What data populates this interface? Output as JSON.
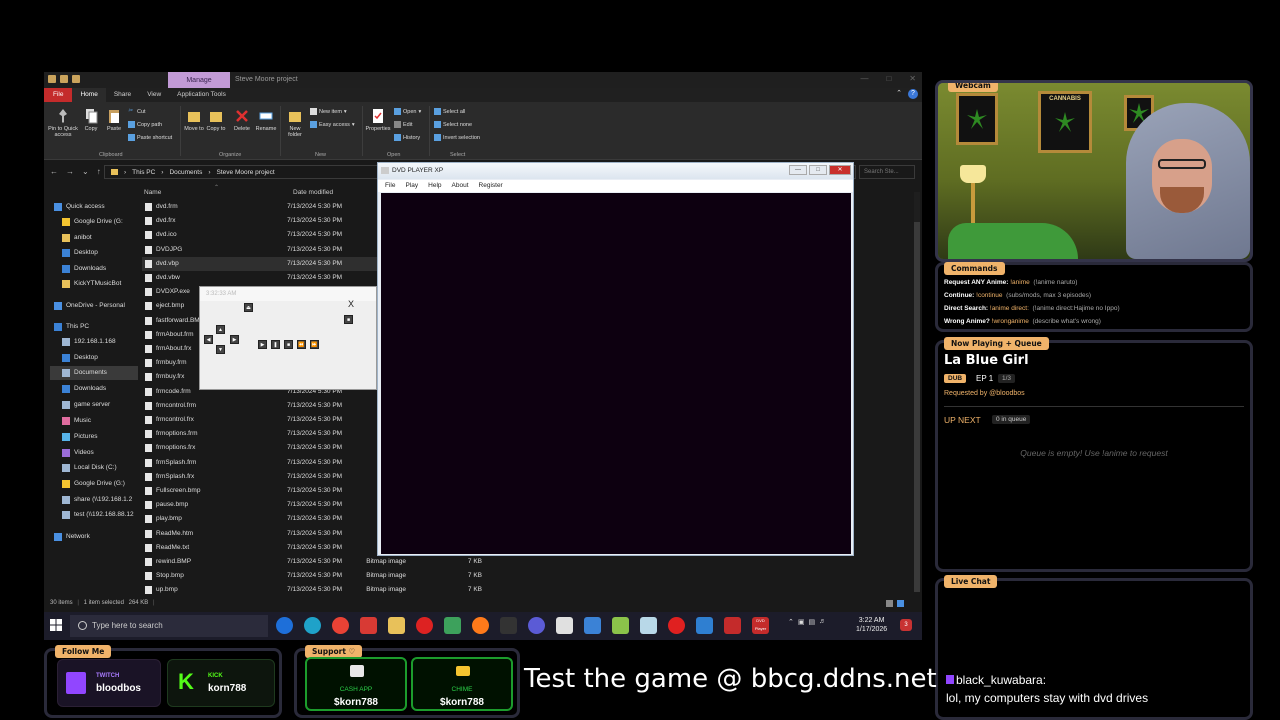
{
  "explorer": {
    "title": "Steve Moore project",
    "manage_tab": "Manage",
    "ribbon_tabs": [
      "File",
      "Home",
      "Share",
      "View",
      "Application Tools"
    ],
    "ribbon": {
      "pin": "Pin to Quick access",
      "copy": "Copy",
      "paste": "Paste",
      "cut": "Cut",
      "copy_path": "Copy path",
      "paste_shortcut": "Paste shortcut",
      "clipboard_group": "Clipboard",
      "move_to": "Move to",
      "copy_to": "Copy to",
      "delete": "Delete",
      "rename": "Rename",
      "organize_group": "Organize",
      "new_folder": "New folder",
      "new_item": "New item",
      "easy_access": "Easy access",
      "new_group": "New",
      "properties": "Properties",
      "open": "Open",
      "edit": "Edit",
      "history": "History",
      "open_group": "Open",
      "select_all": "Select all",
      "select_none": "Select none",
      "invert_selection": "Invert selection",
      "select_group": "Select"
    },
    "breadcrumb": [
      "This PC",
      "Documents",
      "Steve Moore project"
    ],
    "search_placeholder": "Search Ste...",
    "columns": {
      "name": "Name",
      "date": "Date modified"
    },
    "nav": [
      {
        "label": "Quick access",
        "icon": "star-icon",
        "color": "#4a90e2"
      },
      {
        "label": "Google Drive (G:",
        "icon": "drive-icon",
        "color": "#f4c430"
      },
      {
        "label": "anibot",
        "icon": "folder-icon",
        "color": "#e8c15a"
      },
      {
        "label": "Desktop",
        "icon": "desktop-icon",
        "color": "#3b82d6"
      },
      {
        "label": "Downloads",
        "icon": "download-icon",
        "color": "#3b82d6"
      },
      {
        "label": "KickYTMusicBot",
        "icon": "folder-icon",
        "color": "#e8c15a"
      },
      {
        "label": "OneDrive - Personal",
        "icon": "cloud-icon",
        "color": "#4a90e2"
      },
      {
        "label": "This PC",
        "icon": "pc-icon",
        "color": "#3b82d6"
      },
      {
        "label": "192.168.1.168",
        "icon": "network-drive-icon",
        "color": "#9fb7d3"
      },
      {
        "label": "Desktop",
        "icon": "desktop-icon",
        "color": "#3b82d6"
      },
      {
        "label": "Documents",
        "icon": "documents-icon",
        "color": "#9fb7d3"
      },
      {
        "label": "Downloads",
        "icon": "download-icon",
        "color": "#3b82d6"
      },
      {
        "label": "game server",
        "icon": "network-drive-icon",
        "color": "#9fb7d3"
      },
      {
        "label": "Music",
        "icon": "music-icon",
        "color": "#e06c9f"
      },
      {
        "label": "Pictures",
        "icon": "pictures-icon",
        "color": "#57b3e8"
      },
      {
        "label": "Videos",
        "icon": "videos-icon",
        "color": "#9b6cd9"
      },
      {
        "label": "Local Disk (C:)",
        "icon": "disk-icon",
        "color": "#9fb7d3"
      },
      {
        "label": "Google Drive (G:)",
        "icon": "drive-icon",
        "color": "#f4c430"
      },
      {
        "label": "share (\\\\192.168.1.2",
        "icon": "network-drive-icon",
        "color": "#9fb7d3"
      },
      {
        "label": "test (\\\\192.168.88.12",
        "icon": "network-drive-icon",
        "color": "#9fb7d3"
      },
      {
        "label": "Network",
        "icon": "network-icon",
        "color": "#4a90e2"
      }
    ],
    "files": [
      {
        "name": "dvd.frm",
        "date": "7/13/2024 5:30 PM",
        "type": "",
        "size": ""
      },
      {
        "name": "dvd.frx",
        "date": "7/13/2024 5:30 PM",
        "type": "",
        "size": ""
      },
      {
        "name": "dvd.ico",
        "date": "7/13/2024 5:30 PM",
        "type": "",
        "size": ""
      },
      {
        "name": "DVDJPG",
        "date": "7/13/2024 5:30 PM",
        "type": "",
        "size": ""
      },
      {
        "name": "dvd.vbp",
        "date": "7/13/2024 5:30 PM",
        "type": "",
        "size": ""
      },
      {
        "name": "dvd.vbw",
        "date": "7/13/2024 5:30 PM",
        "type": "",
        "size": ""
      },
      {
        "name": "DVDXP.exe",
        "date": "",
        "type": "",
        "size": ""
      },
      {
        "name": "eject.bmp",
        "date": "",
        "type": "",
        "size": ""
      },
      {
        "name": "fastforward.BM",
        "date": "",
        "type": "",
        "size": ""
      },
      {
        "name": "frmAbout.frm",
        "date": "",
        "type": "",
        "size": ""
      },
      {
        "name": "frmAbout.frx",
        "date": "",
        "type": "",
        "size": ""
      },
      {
        "name": "frmbuy.frm",
        "date": "",
        "type": "",
        "size": ""
      },
      {
        "name": "frmbuy.frx",
        "date": "",
        "type": "",
        "size": ""
      },
      {
        "name": "frmcode.frm",
        "date": "7/13/2024 5:30 PM",
        "type": "",
        "size": ""
      },
      {
        "name": "frmcontrol.frm",
        "date": "7/13/2024 5:30 PM",
        "type": "",
        "size": ""
      },
      {
        "name": "frmcontrol.frx",
        "date": "7/13/2024 5:30 PM",
        "type": "",
        "size": ""
      },
      {
        "name": "frmoptions.frm",
        "date": "7/13/2024 5:30 PM",
        "type": "",
        "size": ""
      },
      {
        "name": "frmoptions.frx",
        "date": "7/13/2024 5:30 PM",
        "type": "",
        "size": ""
      },
      {
        "name": "frmSplash.frm",
        "date": "7/13/2024 5:30 PM",
        "type": "",
        "size": ""
      },
      {
        "name": "frmSplash.frx",
        "date": "7/13/2024 5:30 PM",
        "type": "",
        "size": ""
      },
      {
        "name": "Fullscreen.bmp",
        "date": "7/13/2024 5:30 PM",
        "type": "",
        "size": ""
      },
      {
        "name": "pause.bmp",
        "date": "7/13/2024 5:30 PM",
        "type": "",
        "size": ""
      },
      {
        "name": "play.bmp",
        "date": "7/13/2024 5:30 PM",
        "type": "",
        "size": ""
      },
      {
        "name": "ReadMe.htm",
        "date": "7/13/2024 5:30 PM",
        "type": "",
        "size": ""
      },
      {
        "name": "ReadMe.txt",
        "date": "7/13/2024 5:30 PM",
        "type": "",
        "size": ""
      },
      {
        "name": "rewind.BMP",
        "date": "7/13/2024 5:30 PM",
        "type": "Bitmap image",
        "size": "7 KB"
      },
      {
        "name": "Stop.bmp",
        "date": "7/13/2024 5:30 PM",
        "type": "Bitmap image",
        "size": "7 KB"
      },
      {
        "name": "up.bmp",
        "date": "7/13/2024 5:30 PM",
        "type": "Bitmap image",
        "size": "7 KB"
      }
    ],
    "status": {
      "items": "30 items",
      "selected": "1 item selected",
      "size": "264 KB"
    }
  },
  "dvd_player": {
    "title": "DVD PLAYER XP",
    "menu": [
      "File",
      "Play",
      "Help",
      "About",
      "Register"
    ],
    "screen_color": "#0d0010"
  },
  "control_panel": {
    "title": "3:32:33 AM",
    "close": "X"
  },
  "taskbar": {
    "search_placeholder": "Type here to search",
    "time": "3:22 AM",
    "date": "1/17/2026",
    "dvd_app_label": "DVD Player"
  },
  "webcam": {
    "label": "Webcam",
    "poster_text": "CANNABIS"
  },
  "commands": {
    "label": "Commands",
    "lines": [
      {
        "key": "Request ANY Anime:",
        "cmd": "!anime",
        "desc": "(!anime naruto)"
      },
      {
        "key": "Continue:",
        "cmd": "!continue",
        "desc": "(subs/mods, max 3 episodes)"
      },
      {
        "key": "Direct Search:",
        "cmd": "!anime direct:",
        "desc": "(!anime direct:Hajime no Ippo)"
      },
      {
        "key": "Wrong Anime?",
        "cmd": "!wronganime",
        "desc": "(describe what's wrong)"
      }
    ]
  },
  "now_playing": {
    "label": "Now Playing + Queue",
    "title": "La Blue Girl",
    "badge": "DUB",
    "episode": "EP 1",
    "count": "1/3",
    "requested_by": "Requested by @bloodbos",
    "up_next": "UP NEXT",
    "queue_count": "0 in queue",
    "empty_text": "Queue is empty! Use !anime to request"
  },
  "live_chat": {
    "label": "Live Chat",
    "user": "black_kuwabara:",
    "message": "lol, my computers stay with dvd drives"
  },
  "follow": {
    "label": "Follow Me",
    "twitch": {
      "platform": "TWITCH",
      "name": "bloodbos"
    },
    "kick": {
      "platform": "KICK",
      "name": "korn788"
    }
  },
  "support": {
    "label": "Support ♡",
    "cashapp": {
      "platform": "CASH APP",
      "name": "$korn788"
    },
    "chime": {
      "platform": "CHIME",
      "name": "$korn788"
    }
  },
  "game_text": "Test the game @ bbcg.ddns.net",
  "colors": {
    "accent": "#f0b36a",
    "file_tab": "#c42b2b",
    "manage_tab": "#c29ad6",
    "pay_green": "#1c9c2c",
    "twitch": "#9146ff",
    "kick": "#53fc18"
  }
}
